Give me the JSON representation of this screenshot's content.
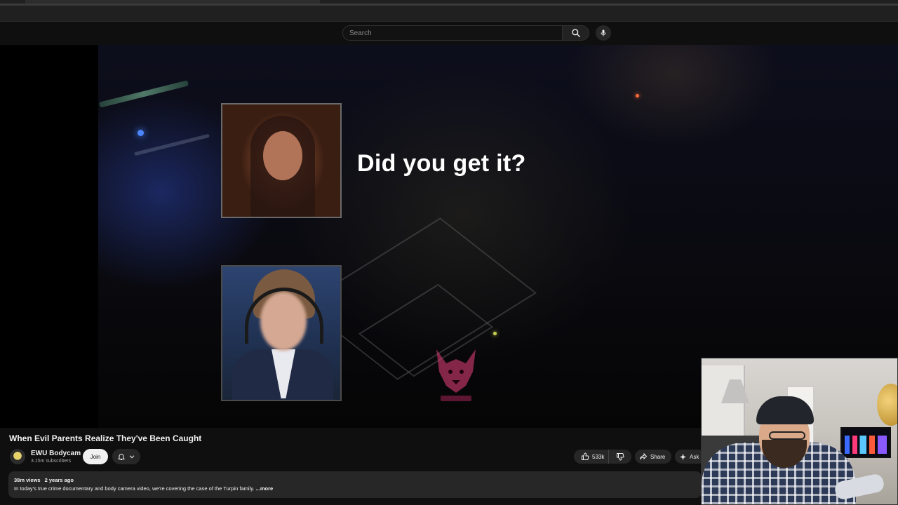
{
  "search": {
    "placeholder": "Search",
    "search_icon": "search-icon",
    "mic_icon": "microphone-icon"
  },
  "video": {
    "caption": "Did you get it?",
    "title": "When Evil Parents Realize They've Been Caught"
  },
  "channel": {
    "name": "EWU Bodycam",
    "subscribers": "3.15m subscribers",
    "join_label": "Join",
    "bell_icon": "bell-icon",
    "chevron_icon": "chevron-down-icon"
  },
  "actions": {
    "like_count": "533k",
    "like_icon": "thumbs-up-icon",
    "dislike_icon": "thumbs-down-icon",
    "share_label": "Share",
    "share_icon": "share-icon",
    "ask_label": "Ask",
    "ask_icon": "sparkle-icon"
  },
  "description": {
    "views": "38m views",
    "age": "2 years ago",
    "text": "In today's true crime documentary and body camera video, we're covering the case of the Turpin family.",
    "more_label": "...more"
  },
  "colors": {
    "background": "#0f0f0f",
    "surface": "#272727",
    "text": "#f1f1f1",
    "muted": "#aaaaaa"
  }
}
